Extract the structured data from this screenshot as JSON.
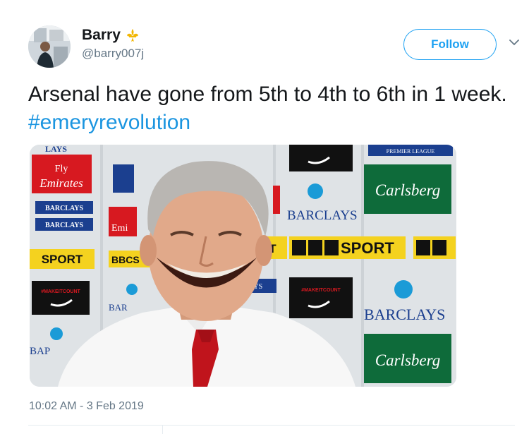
{
  "tweet": {
    "author": {
      "display_name": "Barry",
      "handle": "@barry007j",
      "avatar_icon": "avatar-photo",
      "badge_icon": "fleur-de-lis-emoji"
    },
    "follow_label": "Follow",
    "text_plain": "Arsenal have gone from 5th to 4th to 6th in 1 week. ",
    "hashtag": "#emeryrevolution",
    "timestamp": "10:02 AM - 3 Feb 2019",
    "colors": {
      "accent": "#1da1f2",
      "hashtag": "#1b95e0",
      "secondary_text": "#657786",
      "text": "#14171a"
    }
  },
  "media": {
    "board_texts": {
      "emirates_top": "Fly",
      "emirates_bottom": "Emirates",
      "barclays_1": "BARCLAYS",
      "barclays_2": "BARCLAYS",
      "barclays_center": "BARCLAYS",
      "barclays_right": "BARCLAYS",
      "carlsberg_1": "Carlsberg",
      "carlsberg_2": "Carlsberg",
      "bbc_sport_left": "SPORT",
      "bbc_sport_center": "SPORT",
      "bbc_letters": "BBC",
      "bbc_partial": "BB",
      "makeitcount_left": "#MAKEITCOUNT",
      "makeitcount_right": "#MAKEITCOUNT",
      "premier_league": "PREMIER LEAGUE",
      "bbcs_mid": "BBCS",
      "rt_mid": "RT",
      "emi_mid": "Emi",
      "bar_bottom": "BAR",
      "bap_bottom": "BAP",
      "barclays_top": "LAYS",
      "barclays_small": "BARCLAYS",
      "lays_small": "LAYS"
    }
  }
}
